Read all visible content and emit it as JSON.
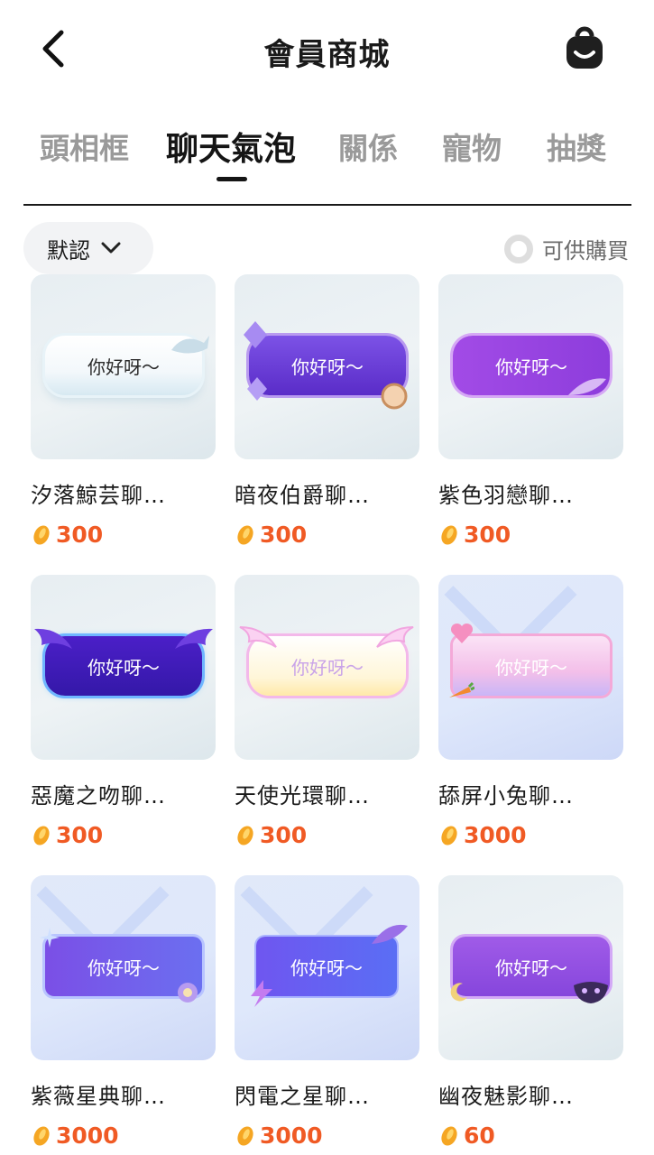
{
  "header": {
    "title": "會員商城",
    "back_icon": "chevron-left-icon",
    "bag_icon": "backpack-icon"
  },
  "tabs": [
    {
      "label": "頭相框",
      "active": false
    },
    {
      "label": "聊天氣泡",
      "active": true
    },
    {
      "label": "關係",
      "active": false
    },
    {
      "label": "寵物",
      "active": false
    },
    {
      "label": "抽獎",
      "active": false
    }
  ],
  "sort": {
    "label": "默認",
    "icon": "chevron-down-icon"
  },
  "filter": {
    "label": "可供購買",
    "checked": false
  },
  "items": [
    {
      "name": "汐落鯨芸聊…",
      "price": "300",
      "bubble_text": "你好呀～"
    },
    {
      "name": "暗夜伯爵聊…",
      "price": "300",
      "bubble_text": "你好呀～"
    },
    {
      "name": "紫色羽戀聊…",
      "price": "300",
      "bubble_text": "你好呀～"
    },
    {
      "name": "惡魔之吻聊…",
      "price": "300",
      "bubble_text": "你好呀～"
    },
    {
      "name": "天使光環聊…",
      "price": "300",
      "bubble_text": "你好呀～"
    },
    {
      "name": "舔屏小兔聊…",
      "price": "3000",
      "bubble_text": "你好呀～"
    },
    {
      "name": "紫薇星典聊…",
      "price": "3000",
      "bubble_text": "你好呀～"
    },
    {
      "name": "閃電之星聊…",
      "price": "3000",
      "bubble_text": "你好呀～"
    },
    {
      "name": "幽夜魅影聊…",
      "price": "60",
      "bubble_text": "你好呀～"
    }
  ],
  "colors": {
    "price": "#f05a24",
    "coin": "#f5a623",
    "active_tab": "#151515",
    "inactive_tab": "#9a9a9a"
  }
}
